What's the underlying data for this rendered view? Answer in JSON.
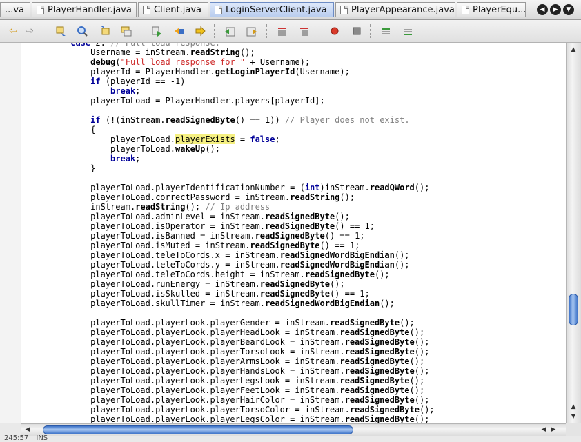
{
  "tabs": [
    {
      "label": "...va",
      "active": false
    },
    {
      "label": "PlayerHandler.java",
      "active": false
    },
    {
      "label": "Client.java",
      "active": false
    },
    {
      "label": "LoginServerClient.java",
      "active": true
    },
    {
      "label": "PlayerAppearance.java",
      "active": false
    },
    {
      "label": "PlayerEqu...",
      "active": false
    }
  ],
  "nav": {
    "prev": "◀",
    "next": "▶",
    "menu": "▼"
  },
  "toolbar": {
    "back_icon": "⇦",
    "forward_icon": "⇨"
  },
  "editor": {
    "highlight_word": "playerExists"
  },
  "status": {
    "position": "245:57",
    "mode": "INS"
  },
  "colors": {
    "keyword": "#000099",
    "string": "#ce2b2b",
    "comment": "#808080",
    "highlight": "#f5f081",
    "scroll_thumb": "#3f74c9"
  }
}
